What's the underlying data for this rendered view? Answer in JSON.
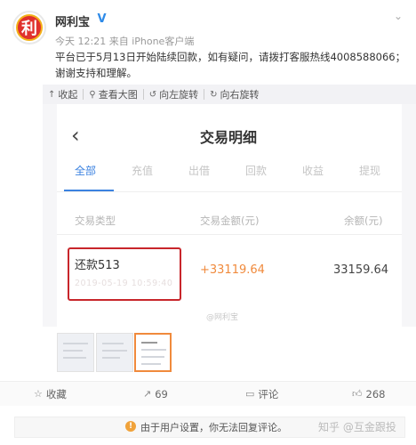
{
  "post": {
    "avatar_char": "利",
    "username": "网利宝",
    "verified_badge": "V",
    "meta": "今天 12:21 来自 iPhone客户端",
    "text": "平台已于5月13日开始陆续回款，如有疑问，请拨打客服热线4008588066；谢谢支持和理解。",
    "dropdown_icon": "chevron-down-icon"
  },
  "image_toolbar": {
    "collapse": "收起",
    "view_large": "查看大图",
    "rotate_left": "向左旋转",
    "rotate_right": "向右旋转"
  },
  "screenshot": {
    "title": "交易明细",
    "tabs": [
      "全部",
      "充值",
      "出借",
      "回款",
      "收益",
      "提现"
    ],
    "active_tab": "全部",
    "columns": [
      "交易类型",
      "交易金额(元)",
      "余额(元)"
    ],
    "row": {
      "type": "还款513",
      "date": "2019-05-19 10:59:40",
      "amount": "+33119.64",
      "balance": "33159.64"
    },
    "watermark": "@网利宝"
  },
  "actions": {
    "favorite": "收藏",
    "repost_count": "69",
    "comment": "评论",
    "like_count": "268"
  },
  "notice": {
    "text": "由于用户设置，你无法回复评论。",
    "source": "知乎 @互金跟投"
  },
  "colors": {
    "accent_blue": "#3b82e0",
    "highlight_red": "#c8262b",
    "amount_orange": "#f08a3c"
  }
}
